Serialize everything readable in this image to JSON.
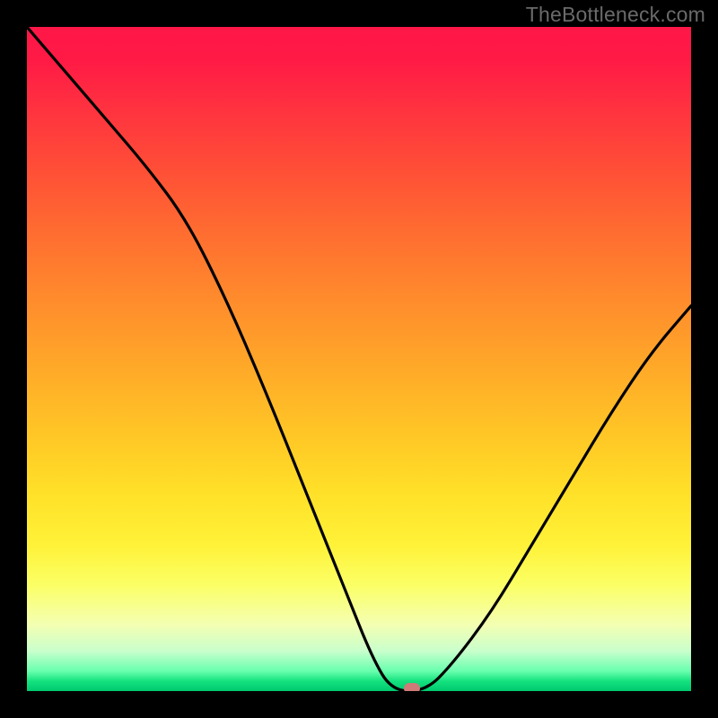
{
  "watermark": "TheBottleneck.com",
  "chart_data": {
    "type": "line",
    "title": "",
    "xlabel": "",
    "ylabel": "",
    "xlim": [
      0,
      100
    ],
    "ylim": [
      0,
      100
    ],
    "grid": false,
    "series": [
      {
        "name": "curve",
        "x": [
          0,
          6,
          12,
          18,
          24,
          30,
          36,
          42,
          48,
          52,
          55,
          60,
          64,
          70,
          76,
          82,
          88,
          94,
          100
        ],
        "values": [
          100,
          93,
          86,
          79,
          71,
          59,
          45,
          30,
          15,
          5,
          0,
          0,
          4,
          12,
          22,
          32,
          42,
          51,
          58
        ]
      }
    ],
    "optimum_marker": {
      "x": 58,
      "y": 0
    },
    "gradient_stops": [
      {
        "pos": 0,
        "color": "#ff1748"
      },
      {
        "pos": 50,
        "color": "#ffab28"
      },
      {
        "pos": 85,
        "color": "#fbff65"
      },
      {
        "pos": 100,
        "color": "#00c870"
      }
    ]
  }
}
